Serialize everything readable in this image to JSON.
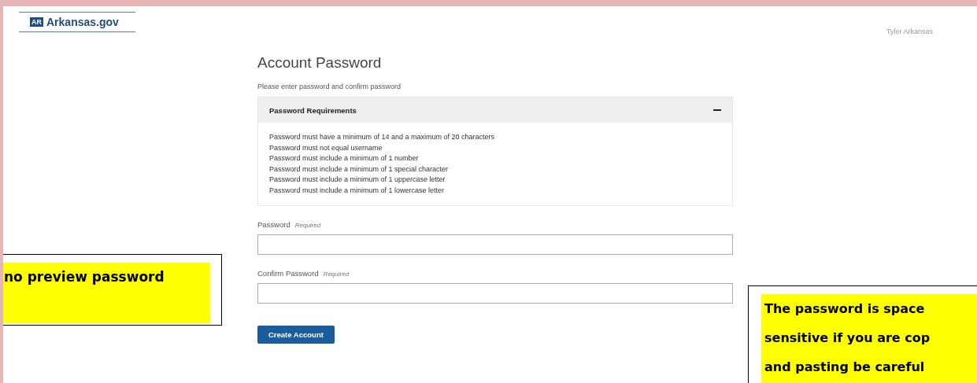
{
  "header": {
    "logo_badge": "AR",
    "logo_text": "Arkansas.gov",
    "user_name": "Tyler Arkansas"
  },
  "form": {
    "title": "Account Password",
    "subtitle": "Please enter password and confirm password",
    "requirements": {
      "title": "Password Requirements",
      "expanded": true,
      "items": [
        "Password must have a minimum of 14 and a maximum of 20 characters",
        "Password must not equal username",
        "Password must include a minimum of 1 number",
        "Password must include a minimum of 1 special character",
        "Password must include a minimum of 1 uppercase letter",
        "Password must include a minimum of 1 lowercase letter"
      ]
    },
    "fields": [
      {
        "label": "Password",
        "hint": "Required"
      },
      {
        "label": "Confirm Password",
        "hint": "Required"
      }
    ],
    "submit": "Create Account"
  },
  "callouts": [
    {
      "kind": "left",
      "lines": [
        "no preview password"
      ]
    },
    {
      "kind": "right",
      "lines": [
        "The password is space",
        "sensitive if you are cop",
        "and pasting be careful"
      ]
    }
  ]
}
